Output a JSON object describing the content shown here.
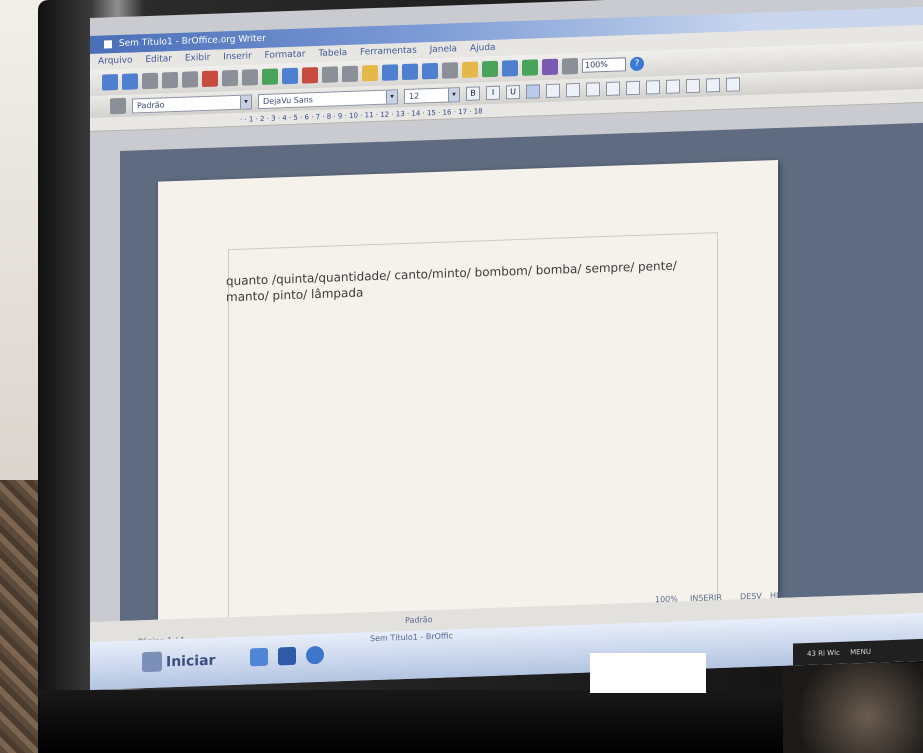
{
  "window": {
    "title": "Sem Título1 - BrOffice.org Writer"
  },
  "menu": [
    "Arquivo",
    "Editar",
    "Exibir",
    "Inserir",
    "Formatar",
    "Tabela",
    "Ferramentas",
    "Janela",
    "Ajuda"
  ],
  "toolbar": {
    "zoom_value": "100%"
  },
  "format_bar": {
    "paragraph_style": "Padrão",
    "font_name": "DejaVu Sans",
    "font_size": "12",
    "bold": "B",
    "italic": "I",
    "underline": "U"
  },
  "ruler": {
    "ticks": "·  ·  1  ·  2  ·  3  ·  4  ·  5  ·  6  ·  7  ·  8  ·  9  ·  10 · 11 · 12 · 13 · 14 · 15 · 16 · 17 · 18"
  },
  "document": {
    "text_line1": "quanto /quinta/quantidade/ canto/minto/ bombom/ bomba/ sempre/ pente/",
    "text_line2": "manto/ pinto/ lâmpada"
  },
  "status": {
    "page": "Página 1 / 1",
    "style": "Padrão",
    "zoom": "100%",
    "mode": "INSERIR",
    "selection": "DESV",
    "extra": "HIF"
  },
  "taskbar": {
    "start_label": "Iniciar",
    "task_label": "Sem Título1 - BrOffic",
    "tray_item1": "43 Ri Wlc",
    "tray_item2": "MENU"
  }
}
